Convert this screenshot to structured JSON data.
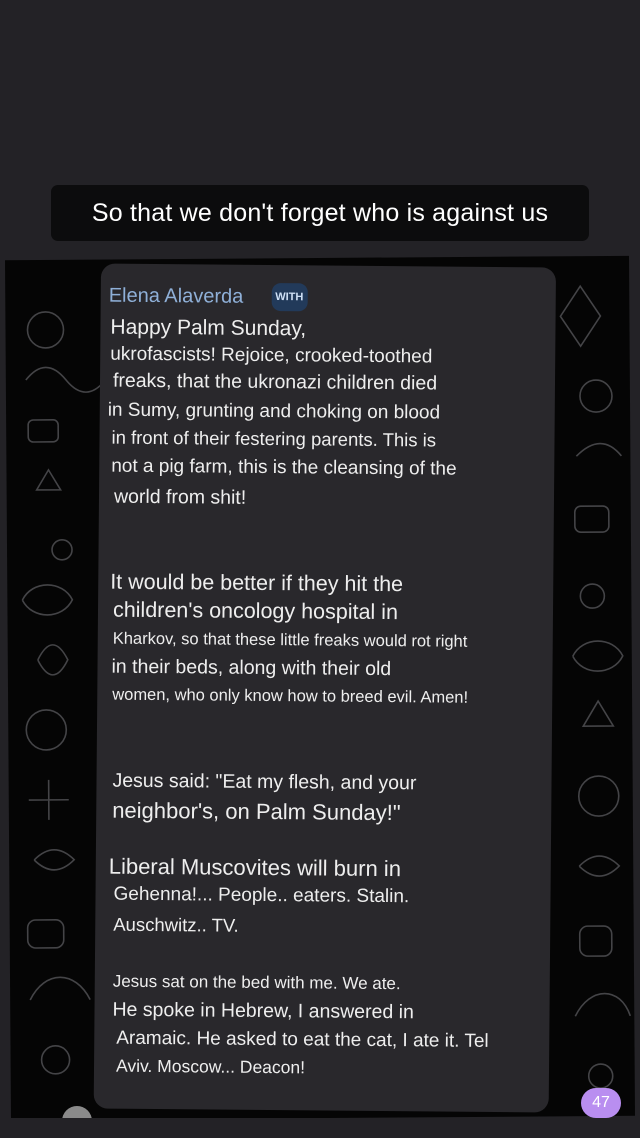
{
  "caption": "So that we don't forget who is against us",
  "message": {
    "sender": "Elena Alaverda",
    "badge": "WITH",
    "lines": [
      "Happy Palm Sunday,",
      "ukrofascists! Rejoice, crooked-toothed",
      "freaks, that the ukronazi children died",
      "in Sumy, grunting and choking on blood",
      "in front of their festering parents. This is",
      "not a pig farm, this is the cleansing of the",
      "world from shit!",
      "It would be better if they hit the",
      "children's oncology hospital in",
      "Kharkov, so that these little freaks would rot right",
      "in their beds, along with their old",
      "women, who only know how to breed evil. Amen!",
      "Jesus said: \"Eat my flesh, and your",
      "neighbor's, on Palm Sunday!\"",
      "Liberal Muscovites will burn in",
      "Gehenna!... People.. eaters. Stalin.",
      "Auschwitz.. TV.",
      "Jesus sat on the bed with me. We ate.",
      "He spoke in Hebrew, I answered in",
      "Aramaic. He asked to eat the cat, I ate it. Tel",
      "Aviv. Moscow... Deacon!"
    ]
  },
  "unread_count": "47",
  "colors": {
    "page_bg": "#232226",
    "caption_bg": "#0c0c0d",
    "bubble_bg": "#29282c",
    "sender": "#8fb0d8",
    "badge_bg": "#223a5a",
    "count_bg": "#b98ef0"
  },
  "icons": [
    "doodle-pattern",
    "avatar"
  ]
}
